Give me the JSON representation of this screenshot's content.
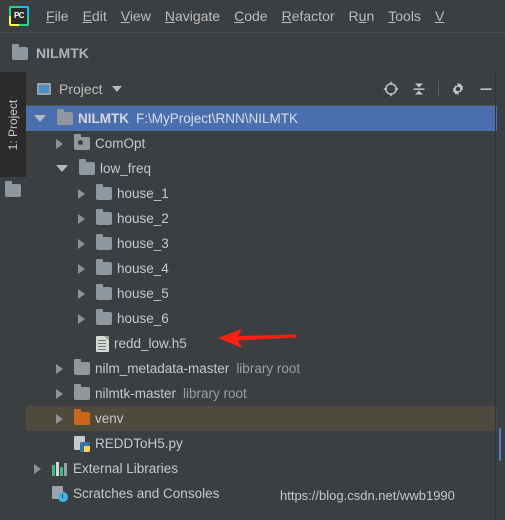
{
  "app": {
    "logo_text": "PC",
    "logo_name": "pycharm-logo"
  },
  "menubar": {
    "items": [
      {
        "label": "File",
        "mnemonic": "F"
      },
      {
        "label": "Edit",
        "mnemonic": "E"
      },
      {
        "label": "View",
        "mnemonic": "V"
      },
      {
        "label": "Navigate",
        "mnemonic": "N"
      },
      {
        "label": "Code",
        "mnemonic": "C"
      },
      {
        "label": "Refactor",
        "mnemonic": "R"
      },
      {
        "label": "Run",
        "mnemonic": "u"
      },
      {
        "label": "Tools",
        "mnemonic": "T"
      },
      {
        "label": "V",
        "mnemonic": "V"
      }
    ]
  },
  "breadcrumb": {
    "icon": "folder-icon",
    "label": "NILMTK"
  },
  "toolstrip": {
    "tab_label": "1: Project",
    "icon": "folder-icon"
  },
  "panel": {
    "icon": "project-window-icon",
    "title": "Project",
    "dropdown_icon": "chevron-down-icon",
    "actions": [
      {
        "name": "locate-in-tree-button",
        "icon": "crosshair-target-icon",
        "tooltip": "Select Opened File"
      },
      {
        "name": "collapse-all-button",
        "icon": "collapse-all-icon",
        "tooltip": "Collapse All"
      },
      {
        "name": "settings-button",
        "icon": "gear-icon",
        "tooltip": "Settings"
      },
      {
        "name": "hide-button",
        "icon": "minimize-icon",
        "tooltip": "Hide"
      }
    ]
  },
  "tree": {
    "rows": [
      {
        "indent": 0,
        "toggle": "open",
        "icon": "folder-icon",
        "label": "NILMTK",
        "sub": "F:\\MyProject\\RNN\\NILMTK",
        "state": "selected",
        "bold": true
      },
      {
        "indent": 1,
        "toggle": "closed",
        "icon": "folder-excluded-icon",
        "label": "ComOpt",
        "sub": "",
        "state": "normal",
        "bold": false
      },
      {
        "indent": 1,
        "toggle": "open",
        "icon": "folder-icon",
        "label": "low_freq",
        "sub": "",
        "state": "normal",
        "bold": false
      },
      {
        "indent": 2,
        "toggle": "closed",
        "icon": "folder-icon",
        "label": "house_1",
        "sub": "",
        "state": "normal",
        "bold": false
      },
      {
        "indent": 2,
        "toggle": "closed",
        "icon": "folder-icon",
        "label": "house_2",
        "sub": "",
        "state": "normal",
        "bold": false
      },
      {
        "indent": 2,
        "toggle": "closed",
        "icon": "folder-icon",
        "label": "house_3",
        "sub": "",
        "state": "normal",
        "bold": false
      },
      {
        "indent": 2,
        "toggle": "closed",
        "icon": "folder-icon",
        "label": "house_4",
        "sub": "",
        "state": "normal",
        "bold": false
      },
      {
        "indent": 2,
        "toggle": "closed",
        "icon": "folder-icon",
        "label": "house_5",
        "sub": "",
        "state": "normal",
        "bold": false
      },
      {
        "indent": 2,
        "toggle": "closed",
        "icon": "folder-icon",
        "label": "house_6",
        "sub": "",
        "state": "normal",
        "bold": false
      },
      {
        "indent": 2,
        "toggle": "none",
        "icon": "h5-file-icon",
        "label": "redd_low.h5",
        "sub": "",
        "state": "normal",
        "bold": false
      },
      {
        "indent": 1,
        "toggle": "closed",
        "icon": "folder-icon",
        "label": "nilm_metadata-master",
        "sub": "library root",
        "state": "normal",
        "bold": false
      },
      {
        "indent": 1,
        "toggle": "closed",
        "icon": "folder-icon",
        "label": "nilmtk-master",
        "sub": "library root",
        "state": "normal",
        "bold": false
      },
      {
        "indent": 1,
        "toggle": "closed",
        "icon": "folder-orange-icon",
        "label": "venv",
        "sub": "",
        "state": "highlight",
        "bold": false
      },
      {
        "indent": 1,
        "toggle": "none",
        "icon": "python-file-icon",
        "label": "REDDToH5.py",
        "sub": "",
        "state": "normal",
        "bold": false
      },
      {
        "indent": 0,
        "toggle": "closed",
        "icon": "external-libraries-icon",
        "label": "External Libraries",
        "sub": "",
        "state": "normal",
        "bold": false
      },
      {
        "indent": 0,
        "toggle": "none",
        "icon": "scratches-icon",
        "label": "Scratches and Consoles",
        "sub": "",
        "state": "normal",
        "bold": false
      }
    ]
  },
  "annotation": {
    "arrow_name": "red-pointer-arrow",
    "arrow_color": "#fb2012",
    "points_to": "redd_low.h5"
  },
  "watermark": {
    "text": "https://blog.csdn.net/wwb1990"
  },
  "colors": {
    "panel_background": "#3c3f41",
    "selection_blue": "#4b6eaf",
    "highlight_olive": "#4e4a3e",
    "text": "#c6c8ca",
    "muted_text": "#9b9fa3",
    "toolstrip_background": "#2b2b2b",
    "scrollbar_thumb": "#4b7fd0"
  }
}
